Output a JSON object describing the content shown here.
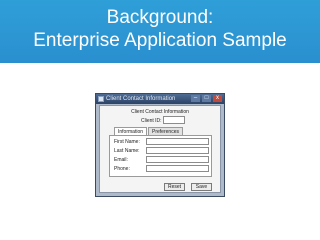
{
  "slide": {
    "title_line1": "Background:",
    "title_line2": "Enterprise Application Sample"
  },
  "window": {
    "title": "Client Contact Information",
    "controls": {
      "minimize": "–",
      "maximize": "□",
      "close": "x"
    }
  },
  "form": {
    "heading": "Client Contact Information",
    "client_id_label": "Client ID:",
    "client_id_value": "",
    "tabs": [
      {
        "label": "Information",
        "active": true
      },
      {
        "label": "Preferences",
        "active": false
      }
    ],
    "fields": [
      {
        "label": "First Name:",
        "value": ""
      },
      {
        "label": "Last Name:",
        "value": ""
      },
      {
        "label": "Email:",
        "value": ""
      },
      {
        "label": "Phone:",
        "value": ""
      }
    ],
    "buttons": {
      "reset": "Reset",
      "save": "Save"
    }
  }
}
